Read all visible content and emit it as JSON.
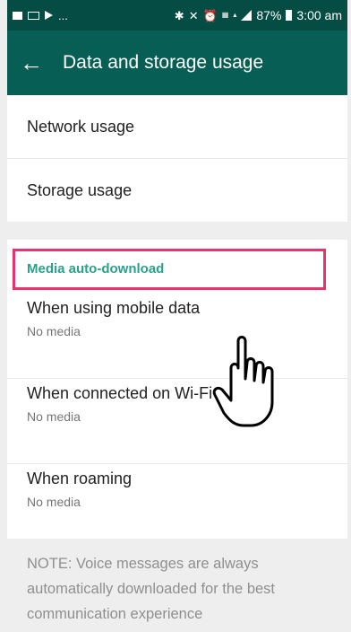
{
  "status_bar": {
    "left_icons": [
      "image-icon",
      "mail-icon",
      "play-icon"
    ],
    "ellipsis": "...",
    "right_icons": [
      "bluetooth-icon",
      "mute-icon",
      "alarm-icon",
      "volte-icon",
      "4g-icon",
      "signal-icon"
    ],
    "battery": "87%",
    "time": "3:00 am"
  },
  "app_bar": {
    "back_icon": "arrow-left-icon",
    "title": "Data and storage usage",
    "color": "#075e54"
  },
  "settings": {
    "network_usage": "Network usage",
    "storage_usage": "Storage usage"
  },
  "media_auto_download": {
    "header": "Media auto-download",
    "header_color": "#2aa18b",
    "highlight_color": "#e8336d",
    "items": [
      {
        "title": "When using mobile data",
        "subtitle": "No media"
      },
      {
        "title": "When connected on Wi-Fi",
        "subtitle": "No media"
      },
      {
        "title": "When roaming",
        "subtitle": "No media"
      }
    ]
  },
  "note": "NOTE: Voice messages are always automatically downloaded for the best communication experience",
  "overlay": {
    "cursor": "hand-pointer-icon"
  }
}
